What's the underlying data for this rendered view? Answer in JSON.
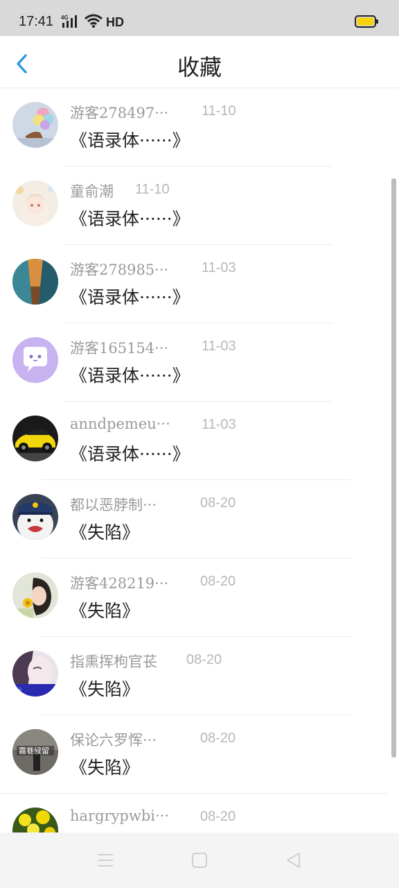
{
  "status_bar": {
    "time": "17:41",
    "network": "4G",
    "hd": "HD",
    "battery_color": "#f5d20c"
  },
  "header": {
    "title": "收藏",
    "back_icon": "chevron-left-icon",
    "accent_color": "#2f9ae0"
  },
  "items": [
    {
      "name": "游客278497···",
      "date": "11-10",
      "title": "《语录体······》",
      "avatar": "balloons"
    },
    {
      "name": "童俞潮",
      "date": "11-10",
      "title": "《语录体······》",
      "avatar": "anime-girl"
    },
    {
      "name": "游客278985···",
      "date": "11-03",
      "title": "《语录体······》",
      "avatar": "denim"
    },
    {
      "name": "游客165154···",
      "date": "11-03",
      "title": "《语录体······》",
      "avatar": "purple-chat"
    },
    {
      "name": "anndpemeu···",
      "date": "11-03",
      "title": "《语录体······》",
      "avatar": "yellow-car"
    },
    {
      "name": "都以恶脖制···",
      "date": "08-20",
      "title": "《失陷》",
      "avatar": "bear"
    },
    {
      "name": "游客428219···",
      "date": "08-20",
      "title": "《失陷》",
      "avatar": "girl-flower"
    },
    {
      "name": "指熏挥枸官苌",
      "date": "08-20",
      "title": "《失陷》",
      "avatar": "girl-face"
    },
    {
      "name": "保论六罗恽···",
      "date": "08-20",
      "title": "《失陷》",
      "avatar": "gray-photo"
    },
    {
      "name": "hargrypwbi···",
      "date": "08-20",
      "title": "",
      "avatar": "yellow-flowers"
    }
  ],
  "nav_bar": {
    "menu_icon": "menu-icon",
    "home_icon": "square-icon",
    "back_icon": "triangle-back-icon"
  }
}
